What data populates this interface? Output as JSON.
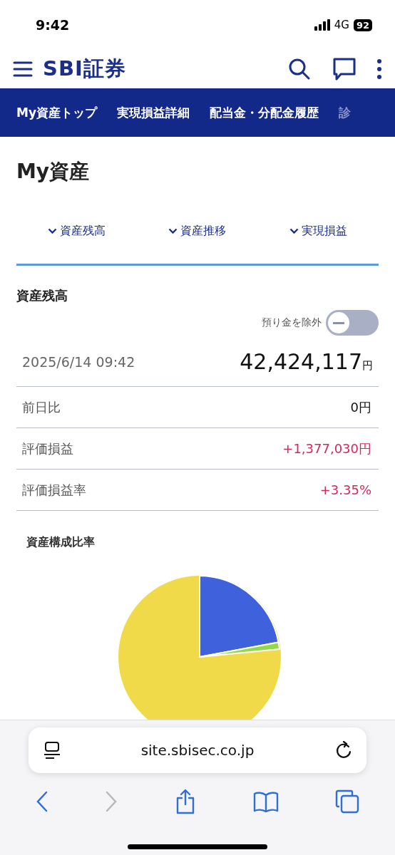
{
  "status_bar": {
    "time": "9:42",
    "network": "4G",
    "battery": "92"
  },
  "header": {
    "logo": "SBI証券"
  },
  "nav": [
    {
      "label": "My資産トップ",
      "faded": false
    },
    {
      "label": "実現損益詳細",
      "faded": false
    },
    {
      "label": "配当金・分配金履歴",
      "faded": false
    },
    {
      "label": "診",
      "faded": true
    }
  ],
  "page_title": "My資産",
  "anchor_tabs": [
    "資産残高",
    "資産推移",
    "実現損益"
  ],
  "balance": {
    "title": "資産残高",
    "toggle": {
      "label": "預り金を除外",
      "on": false
    },
    "timestamp": "2025/6/14 09:42",
    "total": "42,424,117",
    "total_unit": "円",
    "rows": [
      {
        "label": "前日比",
        "value": "0円",
        "positive": false
      },
      {
        "label": "評価損益",
        "value": "+1,377,030円",
        "positive": true
      },
      {
        "label": "評価損益率",
        "value": "+3.35%",
        "positive": true
      }
    ]
  },
  "composition": {
    "title": "資産構成比率"
  },
  "browser": {
    "url": "site.sbisec.co.jp",
    "forward_disabled": true
  }
}
